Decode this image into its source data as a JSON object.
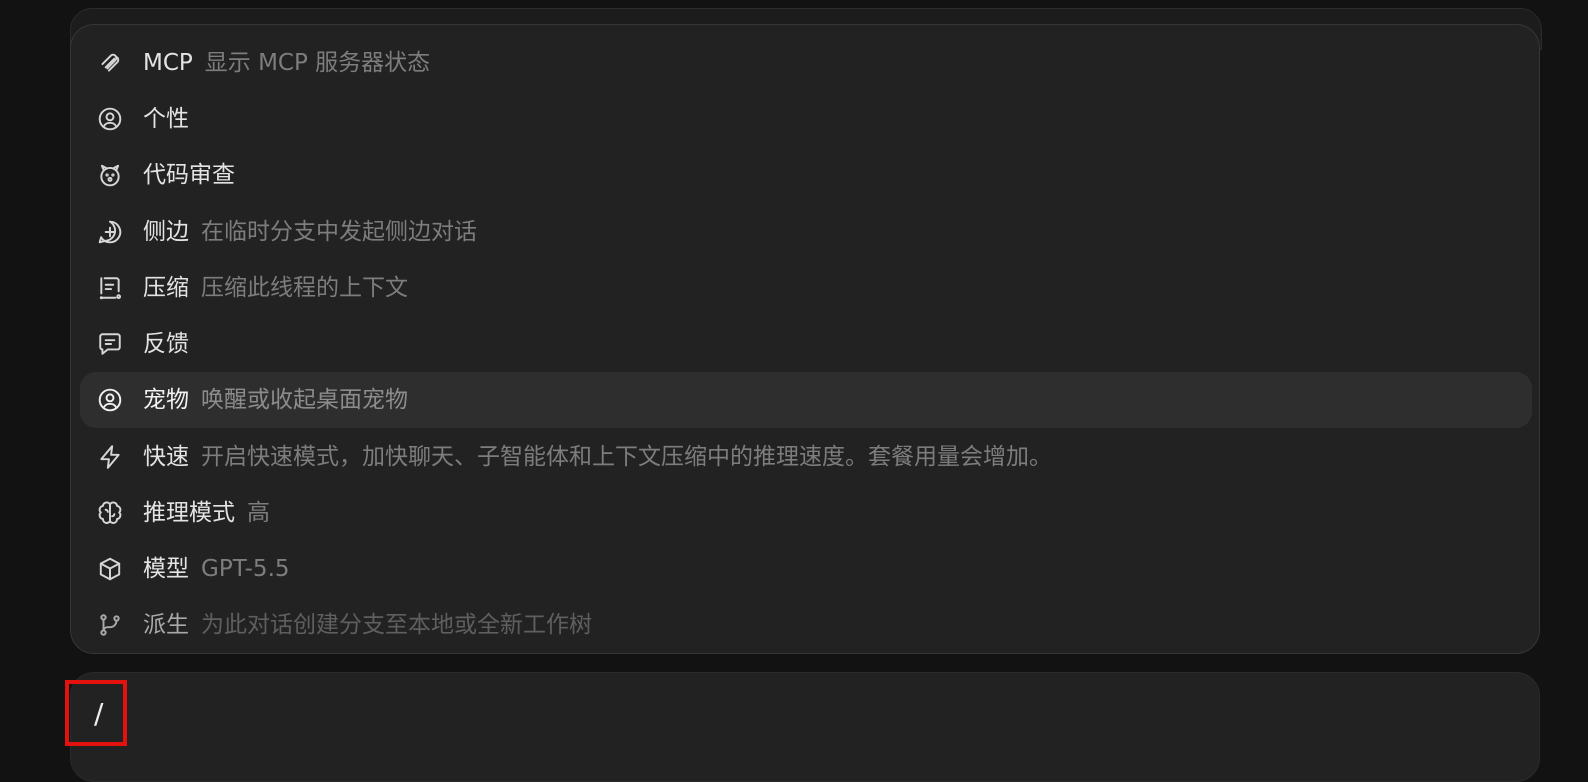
{
  "menu": {
    "items": [
      {
        "icon": "paperclip-stack-icon",
        "name": "MCP",
        "desc": "显示 MCP 服务器状态"
      },
      {
        "icon": "person-circle-icon",
        "name": "个性",
        "desc": ""
      },
      {
        "icon": "bear-face-icon",
        "name": "代码审查",
        "desc": ""
      },
      {
        "icon": "chat-plus-icon",
        "name": "侧边",
        "desc": "在临时分支中发起侧边对话"
      },
      {
        "icon": "compress-doc-icon",
        "name": "压缩",
        "desc": "压缩此线程的上下文"
      },
      {
        "icon": "feedback-bubble-icon",
        "name": "反馈",
        "desc": ""
      },
      {
        "icon": "person-circle-icon",
        "name": "宠物",
        "desc": "唤醒或收起桌面宠物"
      },
      {
        "icon": "lightning-icon",
        "name": "快速",
        "desc": "开启快速模式，加快聊天、子智能体和上下文压缩中的推理速度。套餐用量会增加。"
      },
      {
        "icon": "brain-icon",
        "name": "推理模式",
        "desc": "高"
      },
      {
        "icon": "cube-icon",
        "name": "模型",
        "desc": "GPT-5.5"
      },
      {
        "icon": "git-branch-icon",
        "name": "派生",
        "desc": "为此对话创建分支至本地或全新工作树"
      }
    ]
  },
  "composer": {
    "text": "/"
  },
  "colors": {
    "background": "#121212",
    "panel": "#222222",
    "selected_row": "#2e2e2e",
    "highlight_box": "#e4120f"
  }
}
